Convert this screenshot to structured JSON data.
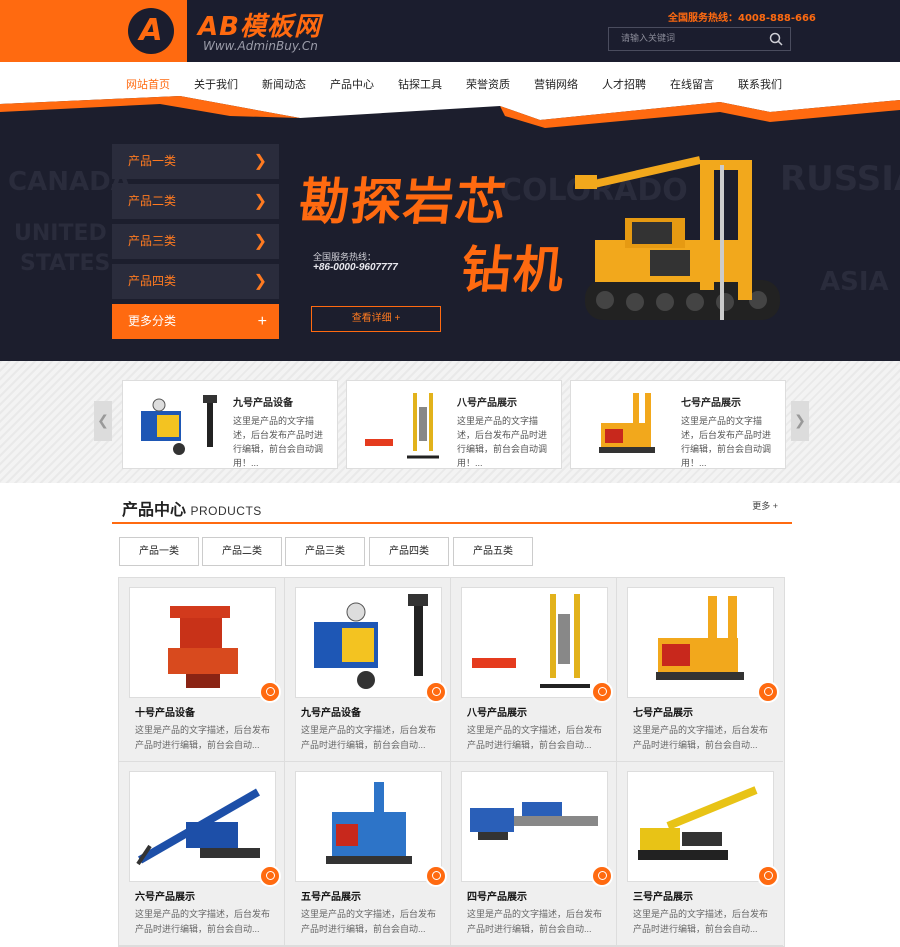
{
  "header": {
    "logo_mark": "A",
    "logo_text": "AB模板网",
    "logo_url": "Www.AdminBuy.Cn",
    "hotline": "全国服务热线：4008-888-666",
    "search_placeholder": "请输入关键词"
  },
  "nav": {
    "items": [
      "网站首页",
      "关于我们",
      "新闻动态",
      "产品中心",
      "钻探工具",
      "荣誉资质",
      "营销网络",
      "人才招聘",
      "在线留言",
      "联系我们"
    ],
    "active": "网站首页"
  },
  "banner": {
    "categories": [
      "产品一类",
      "产品二类",
      "产品三类",
      "产品四类"
    ],
    "more": "更多分类",
    "more_icon": "+",
    "slogan_line1": "勘探岩芯",
    "slogan_line2": "钻机",
    "hotline_label": "全国服务热线：",
    "hotline_number": "+86-0000-9607777",
    "button": "查看详细 +"
  },
  "slider": {
    "items": [
      {
        "title": "九号产品设备",
        "desc": "这里是产品的文字描述，后台发布产品时进行编辑，前台会自动调用！..."
      },
      {
        "title": "八号产品展示",
        "desc": "这里是产品的文字描述，后台发布产品时进行编辑，前台会自动调用！..."
      },
      {
        "title": "七号产品展示",
        "desc": "这里是产品的文字描述，后台发布产品时进行编辑，前台会自动调用！..."
      }
    ]
  },
  "products": {
    "title": "产品中心",
    "title_en": "PRODUCTS",
    "more": "更多 +",
    "tabs": [
      "产品一类",
      "产品二类",
      "产品三类",
      "产品四类",
      "产品五类"
    ],
    "items": [
      {
        "title": "十号产品设备",
        "desc": "这里是产品的文字描述，后台发布产品时进行编辑，前台会自动..."
      },
      {
        "title": "九号产品设备",
        "desc": "这里是产品的文字描述，后台发布产品时进行编辑，前台会自动..."
      },
      {
        "title": "八号产品展示",
        "desc": "这里是产品的文字描述，后台发布产品时进行编辑，前台会自动..."
      },
      {
        "title": "七号产品展示",
        "desc": "这里是产品的文字描述，后台发布产品时进行编辑，前台会自动..."
      },
      {
        "title": "六号产品展示",
        "desc": "这里是产品的文字描述，后台发布产品时进行编辑，前台会自动..."
      },
      {
        "title": "五号产品展示",
        "desc": "这里是产品的文字描述，后台发布产品时进行编辑，前台会自动..."
      },
      {
        "title": "四号产品展示",
        "desc": "这里是产品的文字描述，后台发布产品时进行编辑，前台会自动..."
      },
      {
        "title": "三号产品展示",
        "desc": "这里是产品的文字描述，后台发布产品时进行编辑，前台会自动..."
      }
    ]
  },
  "colors": {
    "accent": "#ff6a10",
    "dark": "#1b1d2e"
  }
}
